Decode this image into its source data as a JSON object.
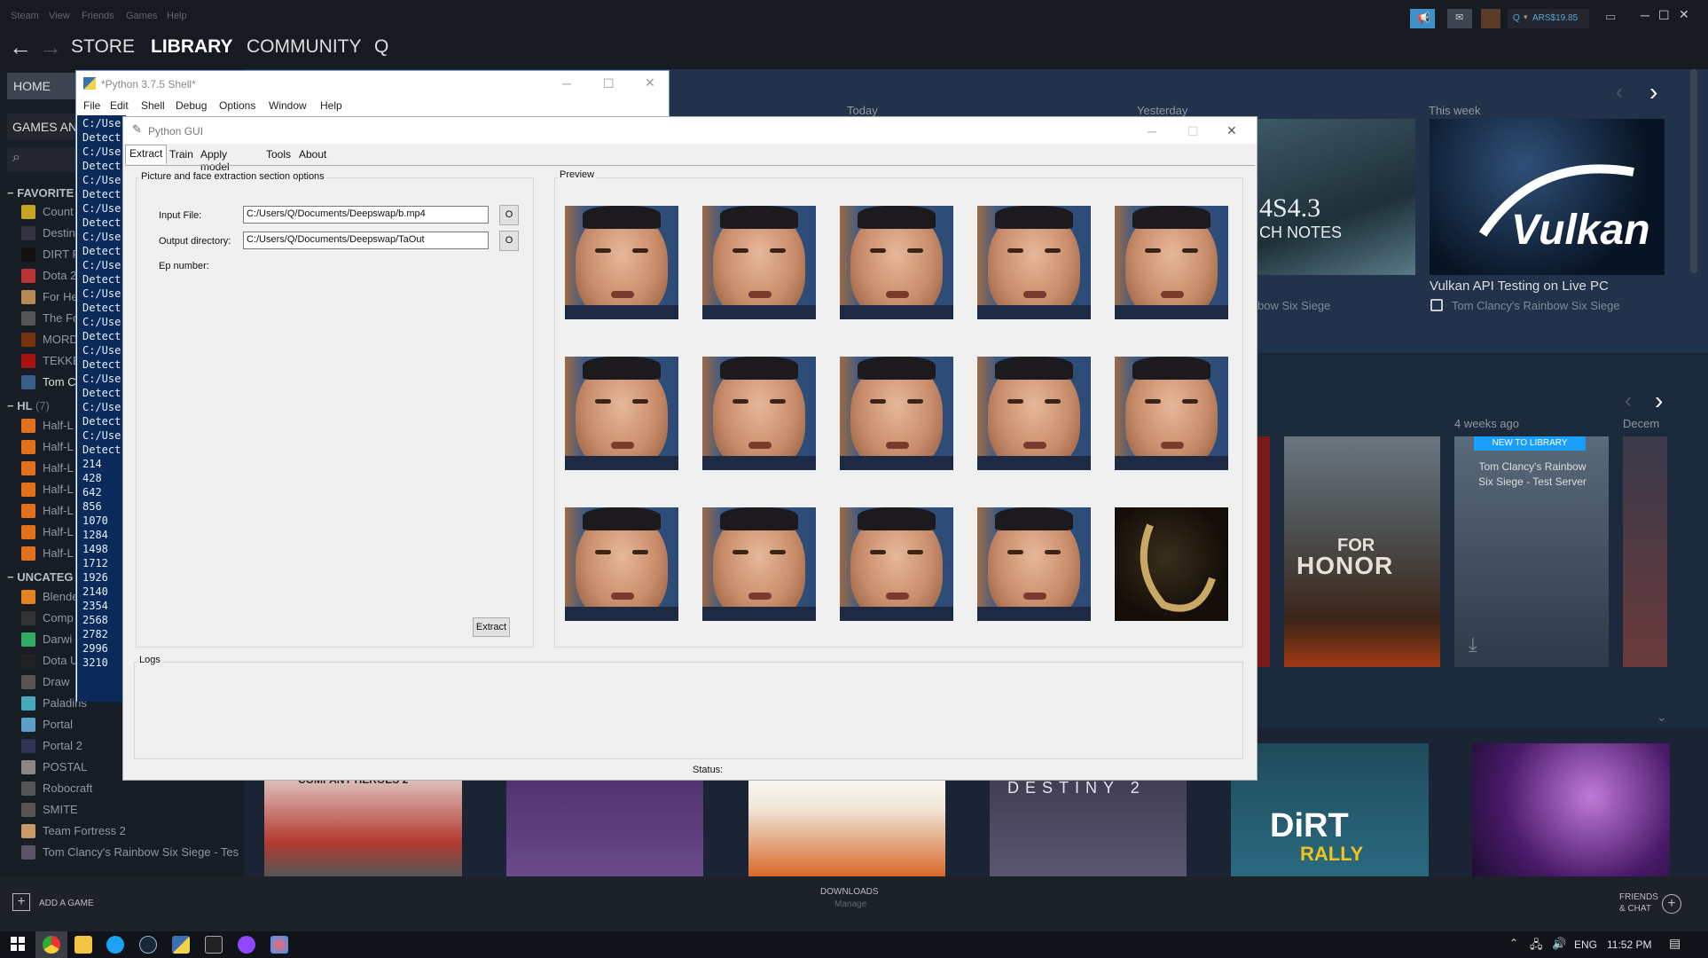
{
  "steam": {
    "menu": [
      "Steam",
      "View",
      "Friends",
      "Games",
      "Help"
    ],
    "nav": {
      "store": "STORE",
      "library": "LIBRARY",
      "community": "COMMUNITY"
    },
    "account": {
      "balance": "ARS$19.85",
      "user": "Q"
    },
    "sidebar": {
      "home": "HOME",
      "games_dropdown": "GAMES ANI",
      "favorites_header": "FAVORITE",
      "favorites": [
        "Count",
        "Destin",
        "DIRT R",
        "Dota 2",
        "For He",
        "The Fo",
        "MORD",
        "TEKKE",
        "Tom C"
      ],
      "hl_header": "HL",
      "hl_count": "(7)",
      "hl_items": [
        "Half-L",
        "Half-L",
        "Half-L",
        "Half-L",
        "Half-L",
        "Half-L",
        "Half-L"
      ],
      "uncategorized_header": "UNCATEG",
      "uncategorized": [
        "Blende",
        "Comp",
        "Darwi",
        "Dota U",
        "Draw",
        "Paladins",
        "Portal",
        "Portal 2",
        "POSTAL",
        "Robocraft",
        "SMITE",
        "Team Fortress 2",
        "Tom Clancy's Rainbow Six Siege - Tes"
      ]
    },
    "shelf": {
      "today": "Today",
      "yesterday": "Yesterday",
      "this_week": "This week",
      "news_title": "Vulkan API Testing on Live PC",
      "news_game": "Tom Clancy's Rainbow Six Siege",
      "news_game_left": "bow Six Siege",
      "patch_text": "4S4.3",
      "patch_sub": "CH NOTES",
      "vulkan_logo": "Vulkan"
    },
    "recent": {
      "four_weeks": "4 weeks ago",
      "december": "Decem",
      "new_badge": "NEW TO LIBRARY",
      "test_server": "Tom Clancy's Rainbow Six Siege - Test Server",
      "for_honor_a": "FOR",
      "for_honor_b": "HONOR"
    },
    "lower_row": {
      "coh": "COMPANY HEROES 2",
      "destiny": "DESTINY 2",
      "dirt_a": "DiRT",
      "dirt_b": "RALLY"
    },
    "bottom": {
      "add_game": "ADD A GAME",
      "downloads": "DOWNLOADS",
      "manage": "Manage",
      "friends": "FRIENDS",
      "chat": "& CHAT"
    }
  },
  "shell": {
    "title": "*Python 3.7.5 Shell*",
    "menu": [
      "File",
      "Edit",
      "Shell",
      "Debug",
      "Options",
      "Window",
      "Help"
    ],
    "lines": [
      "C:/Use",
      "Detect",
      "C:/Use",
      "Detect",
      "C:/Use",
      "Detect",
      "C:/Use",
      "Detect",
      "C:/Use",
      "Detect",
      "C:/Use",
      "Detect",
      "C:/Use",
      "Detect",
      "C:/Use",
      "Detect",
      "C:/Use",
      "Detect",
      "C:/Use",
      "Detect",
      "C:/Use",
      "Detect",
      "C:/Use",
      "Detect",
      "214",
      "428",
      "642",
      "856",
      "1070",
      "1284",
      "1498",
      "1712",
      "1926",
      "2140",
      "2354",
      "2568",
      "2782",
      "2996",
      "3210"
    ]
  },
  "gui": {
    "title": "Python GUI",
    "tabs": [
      "Extract",
      "Train",
      "Apply model",
      "Tools",
      "About"
    ],
    "section_label": "Picture and face extraction section options",
    "input_file_label": "Input File:",
    "input_file_value": "C:/Users/Q/Documents/Deepswap/b.mp4",
    "output_dir_label": "Output directory:",
    "output_dir_value": "C:/Users/Q/Documents/Deepswap/TaOut",
    "browse_label": "O",
    "ep_label": "Ep number:",
    "extract_label": "Extract",
    "preview_label": "Preview",
    "logs_label": "Logs",
    "status_label": "Status:"
  },
  "taskbar": {
    "lang": "ENG",
    "time": "11:52 PM"
  }
}
